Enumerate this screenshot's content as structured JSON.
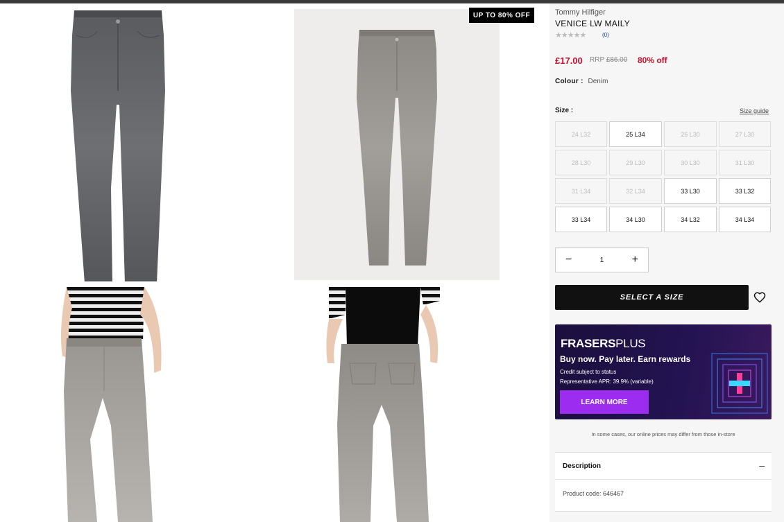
{
  "badge": "UP TO 80% OFF",
  "product": {
    "brand": "Tommy Hilfiger",
    "name": "VENICE LW MAILY",
    "stars": "★★★★★",
    "reviews": "(0)",
    "price": "£17.00",
    "rrp_label": "RRP",
    "rrp_value": "£86.00",
    "discount": "80% off",
    "colour_label": "Colour :",
    "colour_value": "Denim",
    "size_label": "Size :",
    "size_guide": "Size guide"
  },
  "sizes": [
    {
      "label": "24 L32",
      "available": false
    },
    {
      "label": "25 L34",
      "available": true
    },
    {
      "label": "26 L30",
      "available": false
    },
    {
      "label": "27 L30",
      "available": false
    },
    {
      "label": "28 L30",
      "available": false
    },
    {
      "label": "29 L30",
      "available": false
    },
    {
      "label": "30 L30",
      "available": false
    },
    {
      "label": "31 L30",
      "available": false
    },
    {
      "label": "31 L34",
      "available": false
    },
    {
      "label": "32 L34",
      "available": false
    },
    {
      "label": "33 L30",
      "available": true
    },
    {
      "label": "33 L32",
      "available": true
    },
    {
      "label": "33 L34",
      "available": true
    },
    {
      "label": "34 L30",
      "available": true
    },
    {
      "label": "34 L32",
      "available": true
    },
    {
      "label": "34 L34",
      "available": true
    }
  ],
  "quantity": {
    "minus": "−",
    "value": "1",
    "plus": "+"
  },
  "select_button": "SELECT A SIZE",
  "promo": {
    "logo_bold": "FRASERS",
    "logo_light": "PLUS",
    "headline": "Buy now. Pay later. Earn rewards",
    "line1": "Credit subject to status",
    "line2": "Representative APR: 39.9% (variable)",
    "button": "LEARN MORE"
  },
  "price_note": "In some cases, our online prices may differ from those in-store",
  "description": {
    "label": "Description",
    "toggle": "–"
  },
  "product_code": "Product code: 646467",
  "colors": {
    "sale_red": "#c8102e",
    "cta_black": "#111111",
    "promo_purple": "#9b2cf0",
    "promo_bg": "#1a0f3d"
  }
}
